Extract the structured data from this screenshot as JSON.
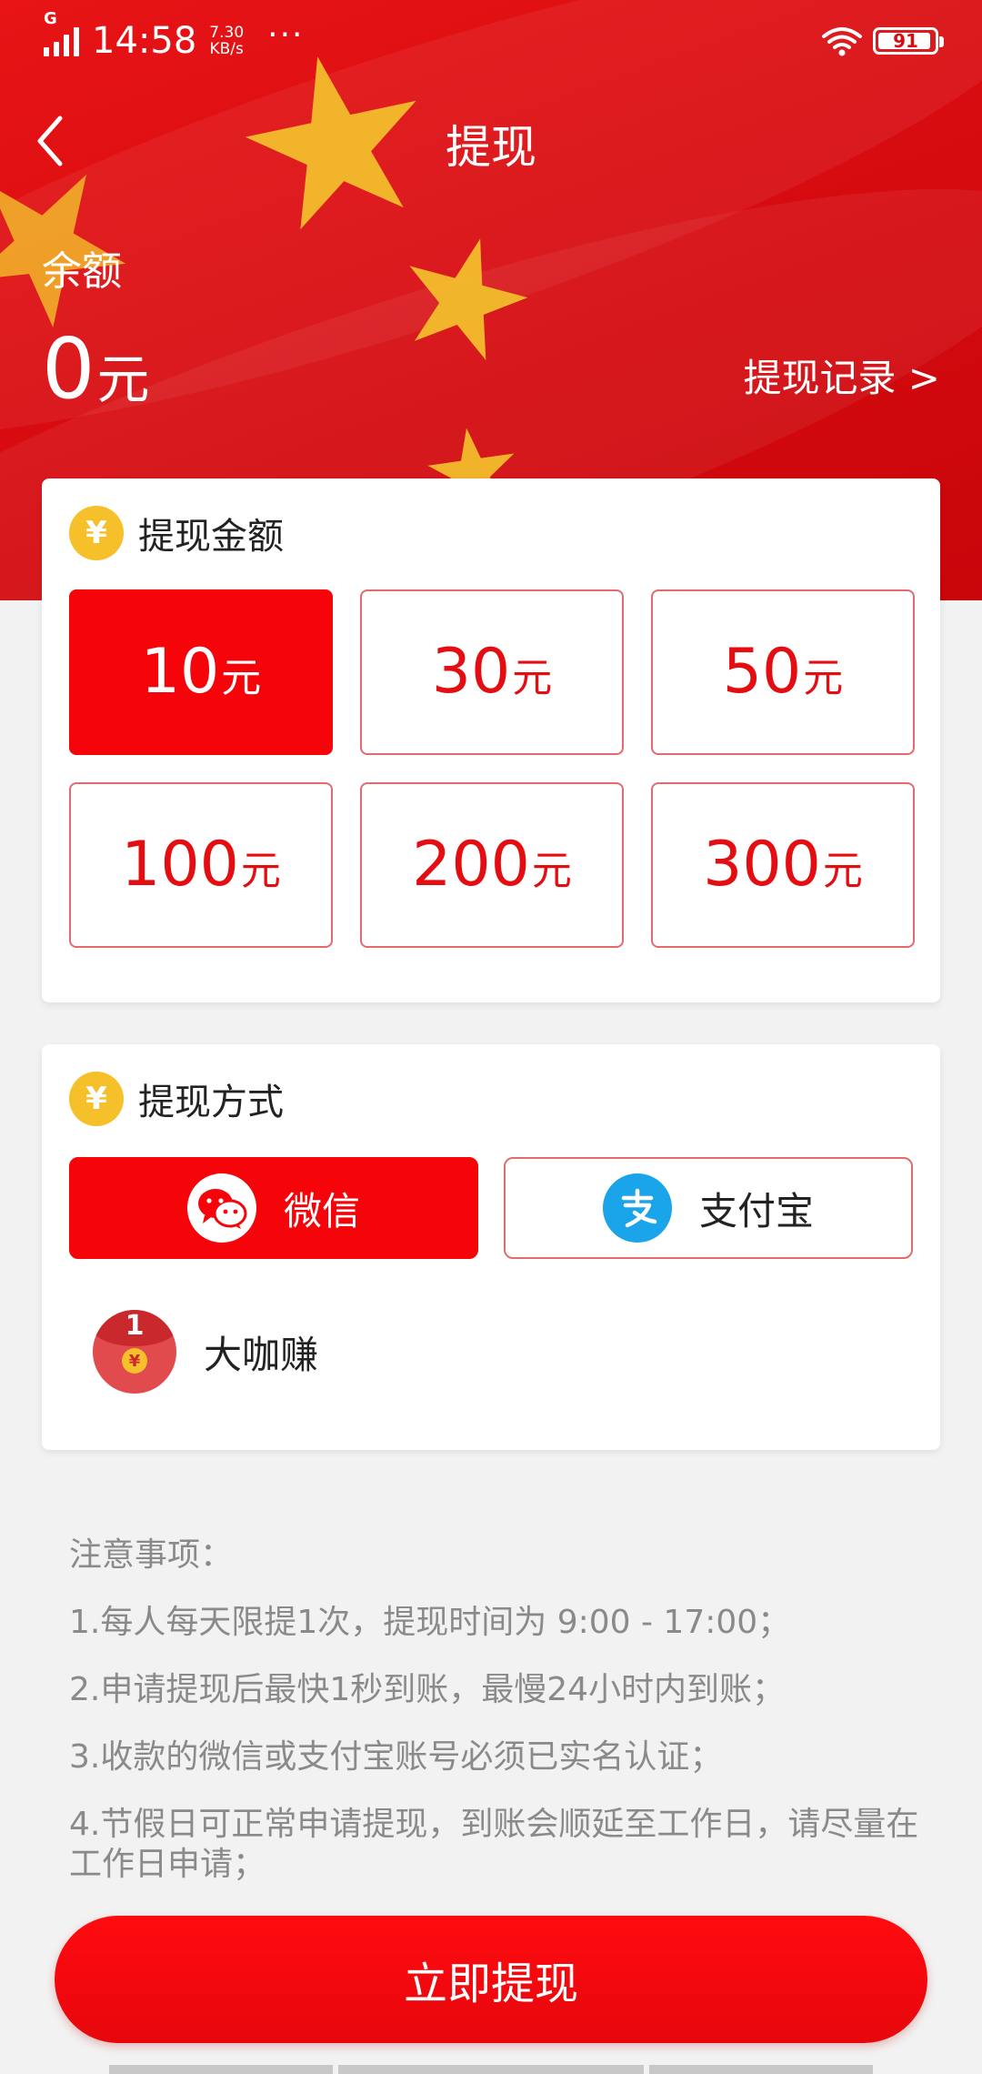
{
  "status_bar": {
    "time": "14:58",
    "network": "G",
    "speed_value": "7.30",
    "speed_unit": "KB/s",
    "more": "···",
    "battery": "91"
  },
  "nav": {
    "back_icon": "chevron-left-icon",
    "title": "提现"
  },
  "balance": {
    "label": "余额",
    "amount": "0",
    "unit": "元",
    "records_link": "提现记录 >"
  },
  "amount_card": {
    "badge_icon": "yen-icon",
    "badge_text": "¥",
    "title": "提现金额",
    "unit": "元",
    "options": [
      {
        "value": "10",
        "selected": true
      },
      {
        "value": "30",
        "selected": false
      },
      {
        "value": "50",
        "selected": false
      },
      {
        "value": "100",
        "selected": false
      },
      {
        "value": "200",
        "selected": false
      },
      {
        "value": "300",
        "selected": false
      }
    ]
  },
  "method_card": {
    "badge_icon": "yen-icon",
    "badge_text": "¥",
    "title": "提现方式",
    "methods": [
      {
        "label": "微信",
        "icon": "wechat-icon",
        "selected": true
      },
      {
        "label": "支付宝",
        "icon": "alipay-icon",
        "selected": false
      }
    ],
    "extra": {
      "label": "大咖赚",
      "icon": "red-envelope-icon",
      "badge_number": "1",
      "badge_symbol": "¥"
    }
  },
  "notes": {
    "title": "注意事项：",
    "items": [
      "1.每人每天限提1次，提现时间为 9:00 - 17:00；",
      "2.申请提现后最快1秒到账，最慢24小时内到账；",
      "3.收款的微信或支付宝账号必须已实名认证；",
      "4.节假日可正常申请提现，到账会顺延至工作日，请尽量在工作日申请；"
    ]
  },
  "cta": {
    "label": "立即提现"
  },
  "colors": {
    "primary_red": "#f5040a",
    "outline_red": "#e36b6e",
    "yen_gold": "#f6c02a",
    "alipay_blue": "#1aa4ea",
    "page_bg": "#f2f2f2"
  }
}
